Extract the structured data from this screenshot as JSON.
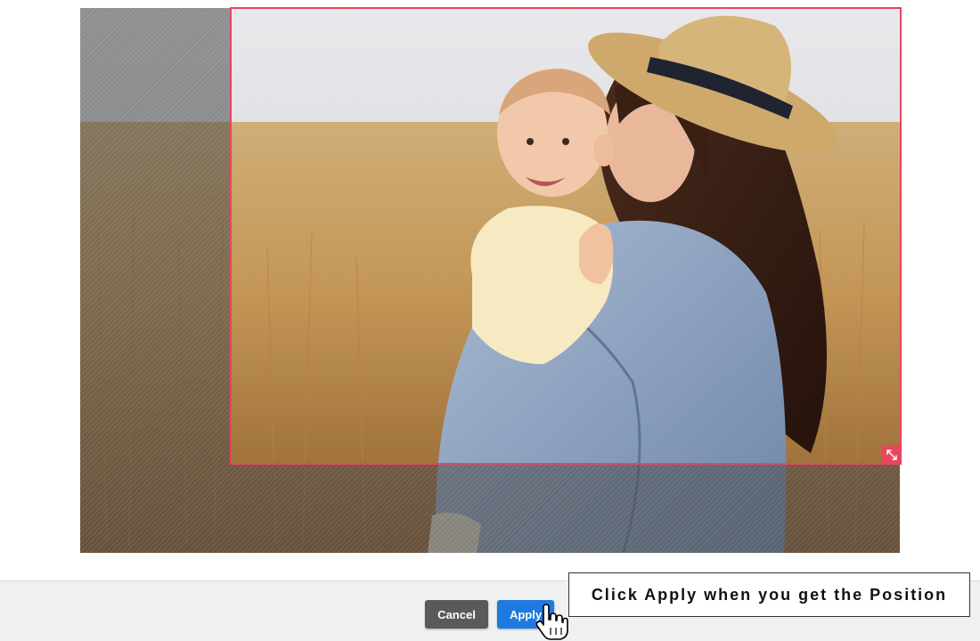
{
  "editor": {
    "cancel_label": "Cancel",
    "apply_label": "Apply",
    "hint_text": "Click Apply when you get the Position"
  },
  "colors": {
    "crop_border": "#e8455f",
    "apply_button": "#1e7ae0",
    "cancel_button": "#5a5a5a"
  },
  "icons": {
    "resize_handle": "resize-diagonal-icon",
    "cursor": "hand-pointer-icon"
  }
}
